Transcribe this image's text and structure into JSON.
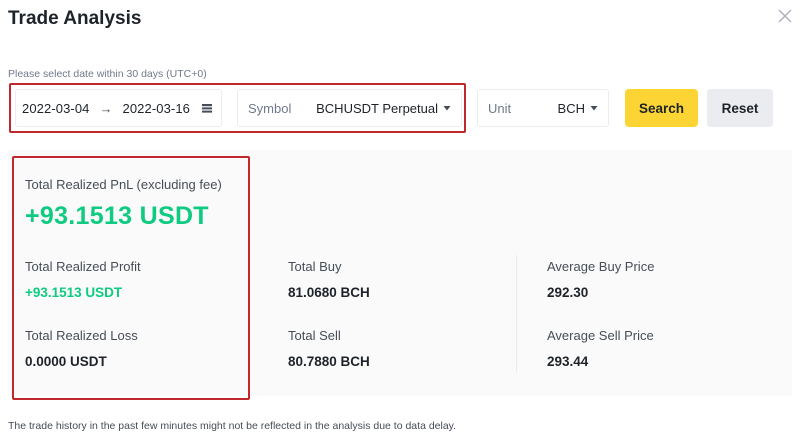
{
  "dialog": {
    "title": "Trade Analysis",
    "close_icon": "close-icon"
  },
  "filters": {
    "hint": "Please select date within 30 days (UTC+0)",
    "date_start": "2022-03-04",
    "date_arrow": "→",
    "date_end": "2022-03-16",
    "calendar_icon": "calendar-icon",
    "symbol_label": "Symbol",
    "symbol_value": "BCHUSDT Perpetual",
    "unit_label": "Unit",
    "unit_value": "BCH",
    "search_label": "Search",
    "reset_label": "Reset"
  },
  "summary": {
    "pnl_label": "Total Realized PnL (excluding fee)",
    "pnl_value": "+93.1513 USDT",
    "realized_profit_label": "Total Realized Profit",
    "realized_profit_value": "+93.1513 USDT",
    "realized_loss_label": "Total Realized Loss",
    "realized_loss_value": "0.0000 USDT",
    "total_buy_label": "Total Buy",
    "total_buy_value": "81.0680 BCH",
    "total_sell_label": "Total Sell",
    "total_sell_value": "80.7880 BCH",
    "avg_buy_label": "Average Buy Price",
    "avg_buy_value": "292.30",
    "avg_sell_label": "Average Sell Price",
    "avg_sell_value": "293.44"
  },
  "footnote": "The trade history in the past few minutes might not be reflected in the analysis due to data delay.",
  "colors": {
    "accent": "#fcd535",
    "positive": "#0ecb81",
    "highlight": "#c0282d"
  }
}
